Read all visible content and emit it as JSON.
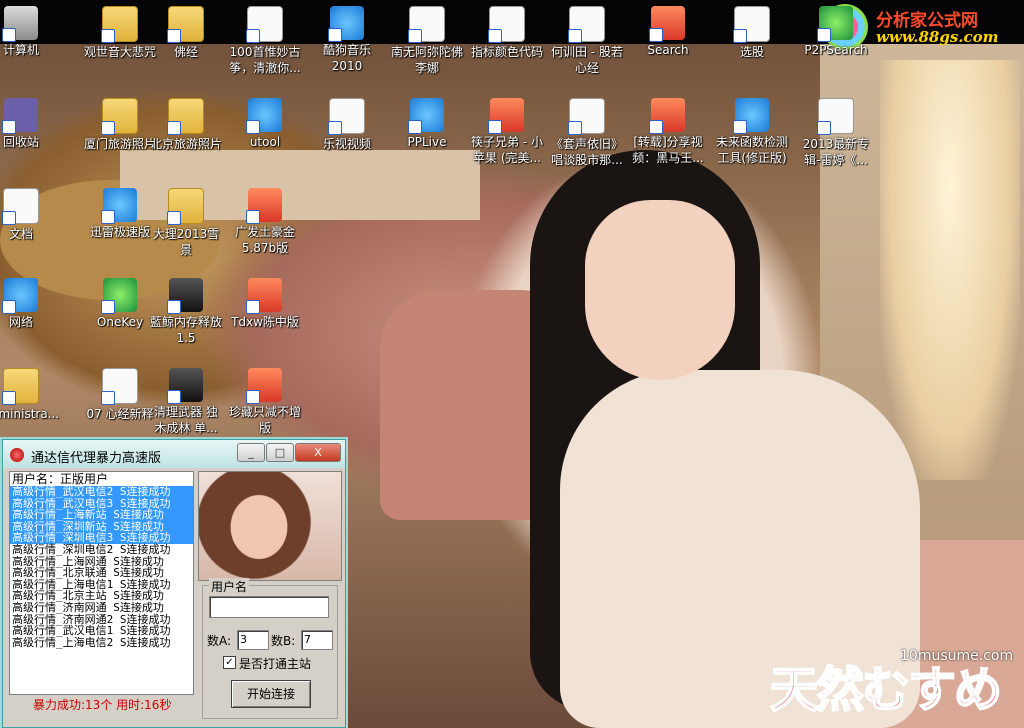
{
  "logo": {
    "title": "分析家公式网",
    "url": "www.88gs.com"
  },
  "watermark": {
    "url": "10musume.com",
    "brand": "天然むすめ"
  },
  "desktop_icons": [
    {
      "label": "计算机",
      "icon": "computer-icon"
    },
    {
      "label": "观世音大悲咒",
      "icon": "folder-icon"
    },
    {
      "label": "佛经",
      "icon": "folder-icon"
    },
    {
      "label": "100首惟妙古\n筝，清澈你...",
      "icon": "audio-file-icon"
    },
    {
      "label": "酷狗音乐\n2010",
      "icon": "kugou-icon"
    },
    {
      "label": "南无阿弥陀佛\n李娜",
      "icon": "audio-file-icon"
    },
    {
      "label": "指标颜色代码",
      "icon": "document-icon"
    },
    {
      "label": "何训田 - 股若\n心经",
      "icon": "mp3-file-icon"
    },
    {
      "label": "Search",
      "icon": "search-app-icon"
    },
    {
      "label": "选股",
      "icon": "document-icon"
    },
    {
      "label": "P2PSearch",
      "icon": "p2psearch-icon"
    },
    {
      "label": "回收站",
      "icon": "recycle-bin-icon"
    },
    {
      "label": "厦门旅游照片",
      "icon": "folder-icon"
    },
    {
      "label": "北京旅游照片",
      "icon": "folder-icon"
    },
    {
      "label": "utool",
      "icon": "utool-icon"
    },
    {
      "label": "乐视视频",
      "icon": "letv-icon"
    },
    {
      "label": "PPLive",
      "icon": "pplive-icon"
    },
    {
      "label": "筷子兄弟 - 小\n苹果 (完美...",
      "icon": "vlc-icon"
    },
    {
      "label": "《套声依旧》\n唱谈股市那...",
      "icon": "document-icon"
    },
    {
      "label": "[转载]分享视\n频：黑马王...",
      "icon": "video-icon"
    },
    {
      "label": "未来函数检测\n工具(修正版)",
      "icon": "tool-icon"
    },
    {
      "label": "2013最新专\n辑-雷婷《...",
      "icon": "audio-file-icon"
    },
    {
      "label": "文档",
      "icon": "documents-icon"
    },
    {
      "label": "迅雷极速版",
      "icon": "xunlei-icon"
    },
    {
      "label": "大理2013雪\n景",
      "icon": "folder-icon"
    },
    {
      "label": "广发土豪金\n5.87b版",
      "icon": "app-icon"
    },
    {
      "label": "网络",
      "icon": "network-icon"
    },
    {
      "label": "OneKey",
      "icon": "onekey-icon"
    },
    {
      "label": "藍鲸内存释放\n1.5",
      "icon": "memory-tool-icon"
    },
    {
      "label": "Tdxw陈中版",
      "icon": "app-icon"
    },
    {
      "label": "Administra...",
      "icon": "user-folder-icon"
    },
    {
      "label": "07 心经新释",
      "icon": "document-icon"
    },
    {
      "label": "清理武器 独\n木成林 单...",
      "icon": "cleaner-icon"
    },
    {
      "label": "珍藏只减不增\n版",
      "icon": "app-icon"
    }
  ],
  "window": {
    "title": "通达信代理暴力高速版",
    "controls": {
      "minimize": "_",
      "maximize": "□",
      "close": "X"
    },
    "list": {
      "header": "用户名：正版用户",
      "rows": [
        {
          "text": "高级行情_武汉电信2  S连接成功",
          "selected": true
        },
        {
          "text": "高级行情_武汉电信3  S连接成功",
          "selected": true
        },
        {
          "text": "高级行情_上海新站    S连接成功",
          "selected": true
        },
        {
          "text": "高级行情_深圳新站    S连接成功",
          "selected": true
        },
        {
          "text": "高级行情_深圳电信3  S连接成功",
          "selected": true
        },
        {
          "text": "高级行情_深圳电信2  S连接成功",
          "selected": false
        },
        {
          "text": "高级行情_上海网通    S连接成功",
          "selected": false
        },
        {
          "text": "高级行情_北京联通    S连接成功",
          "selected": false
        },
        {
          "text": "高级行情_上海电信1  S连接成功",
          "selected": false
        },
        {
          "text": "高级行情_北京主站    S连接成功",
          "selected": false
        },
        {
          "text": "高级行情_济南网通    S连接成功",
          "selected": false
        },
        {
          "text": "高级行情_济南网通2  S连接成功",
          "selected": false
        },
        {
          "text": "高级行情_武汉电信1  S连接成功",
          "selected": false
        },
        {
          "text": "高级行情_上海电信2  S连接成功",
          "selected": false
        }
      ]
    },
    "form": {
      "username_label": "用户名",
      "username_value": "",
      "num_a_label": "数A:",
      "num_a_value": "3",
      "num_b_label": "数B:",
      "num_b_value": "7",
      "checkbox_label": "是否打通主站",
      "checkbox_checked": true,
      "connect_button": "开始连接"
    },
    "status": "暴力成功:13个  用时:16秒"
  }
}
